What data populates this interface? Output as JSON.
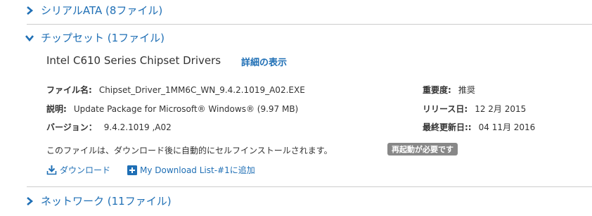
{
  "sections": [
    {
      "label": "シリアルATA (8ファイル)",
      "expanded": false
    },
    {
      "label": "チップセット (1ファイル)",
      "expanded": true
    },
    {
      "label": "ネットワーク (11ファイル)",
      "expanded": false
    }
  ],
  "driver": {
    "title": "Intel C610 Series Chipset Drivers",
    "details_link": "詳細の表示",
    "file_name_label": "ファイル名:",
    "file_name_value": "Chipset_Driver_1MM6C_WN_9.4.2.1019_A02.EXE",
    "description_label": "説明:",
    "description_value": "Update Package for Microsoft® Windows® (9.97 MB)",
    "version_label": "バージョン：",
    "version_value": "9.4.2.1019 ,A02",
    "importance_label": "重要度:",
    "importance_value": "推奨",
    "release_label": "リリース日:",
    "release_value": "12 2月 2015",
    "updated_label": "最終更新日::",
    "updated_value": "04 11月 2016",
    "auto_install_note": "このファイルは、ダウンロード後に自動的にセルフインストールされます。",
    "restart_badge": "再起動が必要です"
  },
  "actions": {
    "download": "ダウンロード",
    "add_to_list": "My Download List-#1に追加"
  },
  "colors": {
    "link": "#1f6fb5",
    "divider": "#cccccc",
    "badge_bg": "#888888"
  },
  "icons": {
    "collapsed": "chevron-right-icon",
    "expanded": "chevron-down-icon",
    "download": "download-icon",
    "add": "plus-square-icon"
  }
}
